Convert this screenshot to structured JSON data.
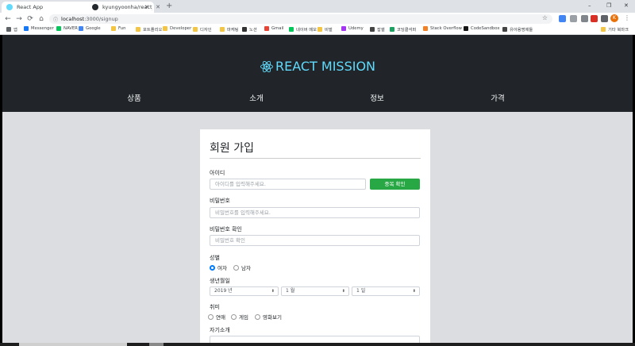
{
  "browser": {
    "tabs": [
      {
        "title": "React App",
        "favicon_color": "#61dafb",
        "active": true
      },
      {
        "title": "kyungyoonha/react_mission5",
        "favicon_color": "#24292e",
        "active": false
      }
    ],
    "new_tab_glyph": "+",
    "window_controls": [
      "–",
      "❐",
      "✕"
    ],
    "url": {
      "host": "localhost",
      "path": ":3000/signup"
    },
    "nav_glyphs": {
      "back": "←",
      "forward": "→",
      "reload": "⟳",
      "home": "⌂"
    },
    "profile_initial": "K",
    "bookmarks": [
      {
        "label": "앱",
        "icon": "apps-icon",
        "color": "#5f6368"
      },
      {
        "label": "Messenger",
        "icon": "messenger-icon",
        "color": "#1877f2"
      },
      {
        "label": "NAVER",
        "icon": "naver-icon",
        "color": "#03c75a"
      },
      {
        "label": "Google",
        "icon": "google-icon",
        "color": "#4285f4"
      },
      {
        "label": "Fun",
        "icon": "folder-icon",
        "color": "#f4c542"
      },
      {
        "label": "포트폴리오",
        "icon": "folder-icon",
        "color": "#f4c542"
      },
      {
        "label": "Developer",
        "icon": "folder-icon",
        "color": "#f4c542"
      },
      {
        "label": "디자인",
        "icon": "folder-icon",
        "color": "#f4c542"
      },
      {
        "label": "마케팅",
        "icon": "folder-icon",
        "color": "#f4c542"
      },
      {
        "label": "노션",
        "icon": "notion-icon",
        "color": "#333333"
      },
      {
        "label": "Gmail",
        "icon": "gmail-icon",
        "color": "#ea4335"
      },
      {
        "label": "네이버 메모",
        "icon": "memo-icon",
        "color": "#03c75a"
      },
      {
        "label": "비벌",
        "icon": "folder-icon",
        "color": "#f4c542"
      },
      {
        "label": "Udemy",
        "icon": "udemy-icon",
        "color": "#a435f0"
      },
      {
        "label": "잡썰",
        "icon": "globe-icon",
        "color": "#444444"
      },
      {
        "label": "코딩클석퍼",
        "icon": "code-icon",
        "color": "#1aa260"
      },
      {
        "label": "Stack Overflow",
        "icon": "stackoverflow-icon",
        "color": "#f48024"
      },
      {
        "label": "CodeSandbox",
        "icon": "codesandbox-icon",
        "color": "#151515"
      },
      {
        "label": "유아용명제들",
        "icon": "globe-icon",
        "color": "#444444"
      },
      {
        "label": "기타 북마크",
        "icon": "folder-icon",
        "color": "#f4c542"
      }
    ]
  },
  "header": {
    "brand": "REACT MISSION",
    "brand_color": "#61dafb",
    "nav": [
      "상품",
      "소개",
      "정보",
      "가격"
    ]
  },
  "signup": {
    "title": "회원 가입",
    "id_label": "아이디",
    "id_placeholder": "아이디를 입력해주세요.",
    "dup_check_label": "중복 확인",
    "password_label": "비밀번호",
    "password_placeholder": "비밀번호를 입력해주세요.",
    "password_confirm_label": "비밀번호 확인",
    "password_confirm_placeholder": "비밀번호 확인",
    "gender_label": "성별",
    "gender_options": [
      {
        "label": "여자",
        "checked": true
      },
      {
        "label": "남자",
        "checked": false
      }
    ],
    "birth_label": "생년월일",
    "birth_year": "2019 년",
    "birth_month": "1 월",
    "birth_day": "1 일",
    "hobby_label": "취미",
    "hobbies": [
      "연애",
      "게임",
      "영화보기"
    ],
    "intro_label": "자기소개"
  }
}
